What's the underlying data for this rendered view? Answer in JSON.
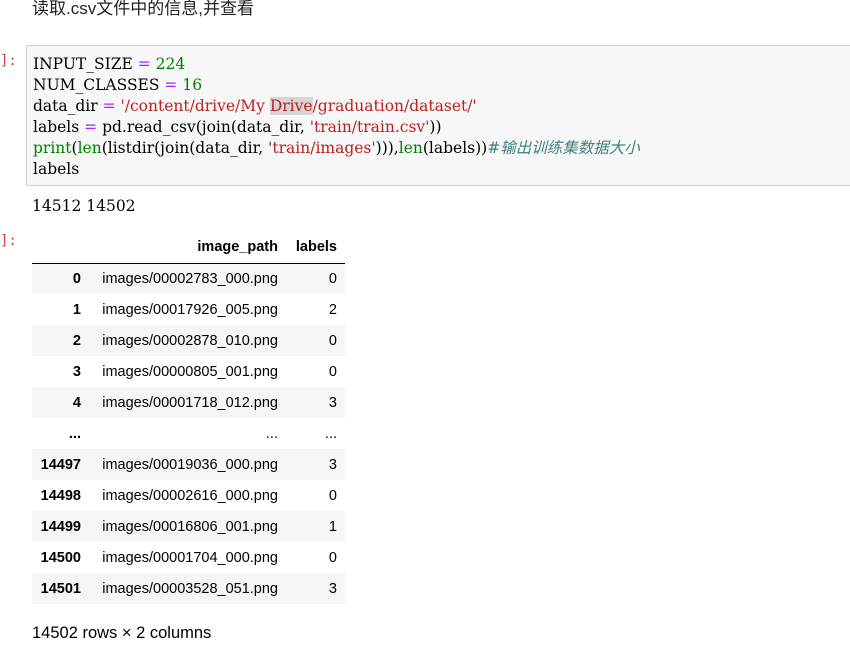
{
  "markdown": {
    "text": "读取.csv文件中的信息,并查看"
  },
  "prompts": {
    "code_in": "]:",
    "out": "]:"
  },
  "code": {
    "l1_var": "INPUT_SIZE",
    "l1_op": " = ",
    "l1_val": "224",
    "l2_var": "NUM_CLASSES",
    "l2_op": " = ",
    "l2_val": "16",
    "l3_var": "data_dir",
    "l3_op": " = ",
    "l3_s1": "'/content/drive/My ",
    "l3_hl": "Drive",
    "l3_s2": "/graduation/dataset/'",
    "l4_a": "labels",
    "l4_op": " = ",
    "l4_b": "pd.read_csv(join(data_dir, ",
    "l4_str": "'train/train.csv'",
    "l4_c": "))",
    "l5_print": "print",
    "l5_a": "(",
    "l5_len": "len",
    "l5_b": "(listdir(join(data_dir, ",
    "l5_str": "'train/images'",
    "l5_c": "))),",
    "l5_len2": "len",
    "l5_d": "(labels))",
    "l5_cm": "#输出训练集数据大小",
    "l6": "labels"
  },
  "output": {
    "text": "14512 14502"
  },
  "table": {
    "headers": [
      "",
      "image_path",
      "labels"
    ],
    "rows": [
      [
        "0",
        "images/00002783_000.png",
        "0"
      ],
      [
        "1",
        "images/00017926_005.png",
        "2"
      ],
      [
        "2",
        "images/00002878_010.png",
        "0"
      ],
      [
        "3",
        "images/00000805_001.png",
        "0"
      ],
      [
        "4",
        "images/00001718_012.png",
        "3"
      ],
      [
        "...",
        "...",
        "..."
      ],
      [
        "14497",
        "images/00019036_000.png",
        "3"
      ],
      [
        "14498",
        "images/00002616_000.png",
        "0"
      ],
      [
        "14499",
        "images/00016806_001.png",
        "1"
      ],
      [
        "14500",
        "images/00001704_000.png",
        "0"
      ],
      [
        "14501",
        "images/00003528_051.png",
        "3"
      ]
    ],
    "shape": "14502 rows × 2 columns"
  }
}
